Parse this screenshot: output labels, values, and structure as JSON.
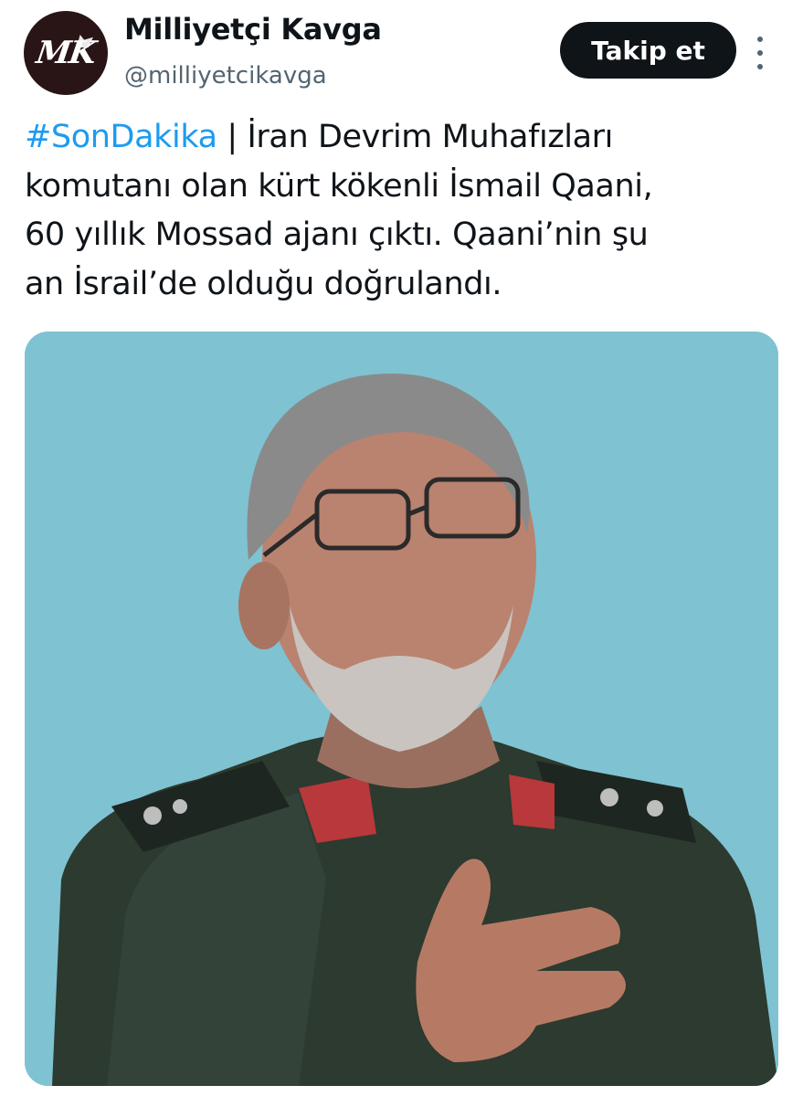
{
  "account": {
    "display_name": "Milliyetçi Kavga",
    "handle": "@milliyetcikavga",
    "avatar_text": "MK"
  },
  "actions": {
    "follow_label": "Takip et",
    "more_icon": "more-vertical-icon"
  },
  "tweet": {
    "hashtag": "#SonDakika",
    "separator": " | ",
    "lines": [
      "İran Devrim Muhafızları",
      "komutanı olan kürt kökenli İsmail Qaani,",
      "60 yıllık Mossad ajanı çıktı. Qaani’nin şu",
      "an İsrail’de olduğu doğrulandı."
    ]
  },
  "media": {
    "background_color": "#7fc2d2",
    "uniform_color": "#2c3a30"
  },
  "colors": {
    "accent": "#1d9bf0",
    "text": "#0f1419",
    "secondary_text": "#536471",
    "button_bg": "#0f1419"
  }
}
